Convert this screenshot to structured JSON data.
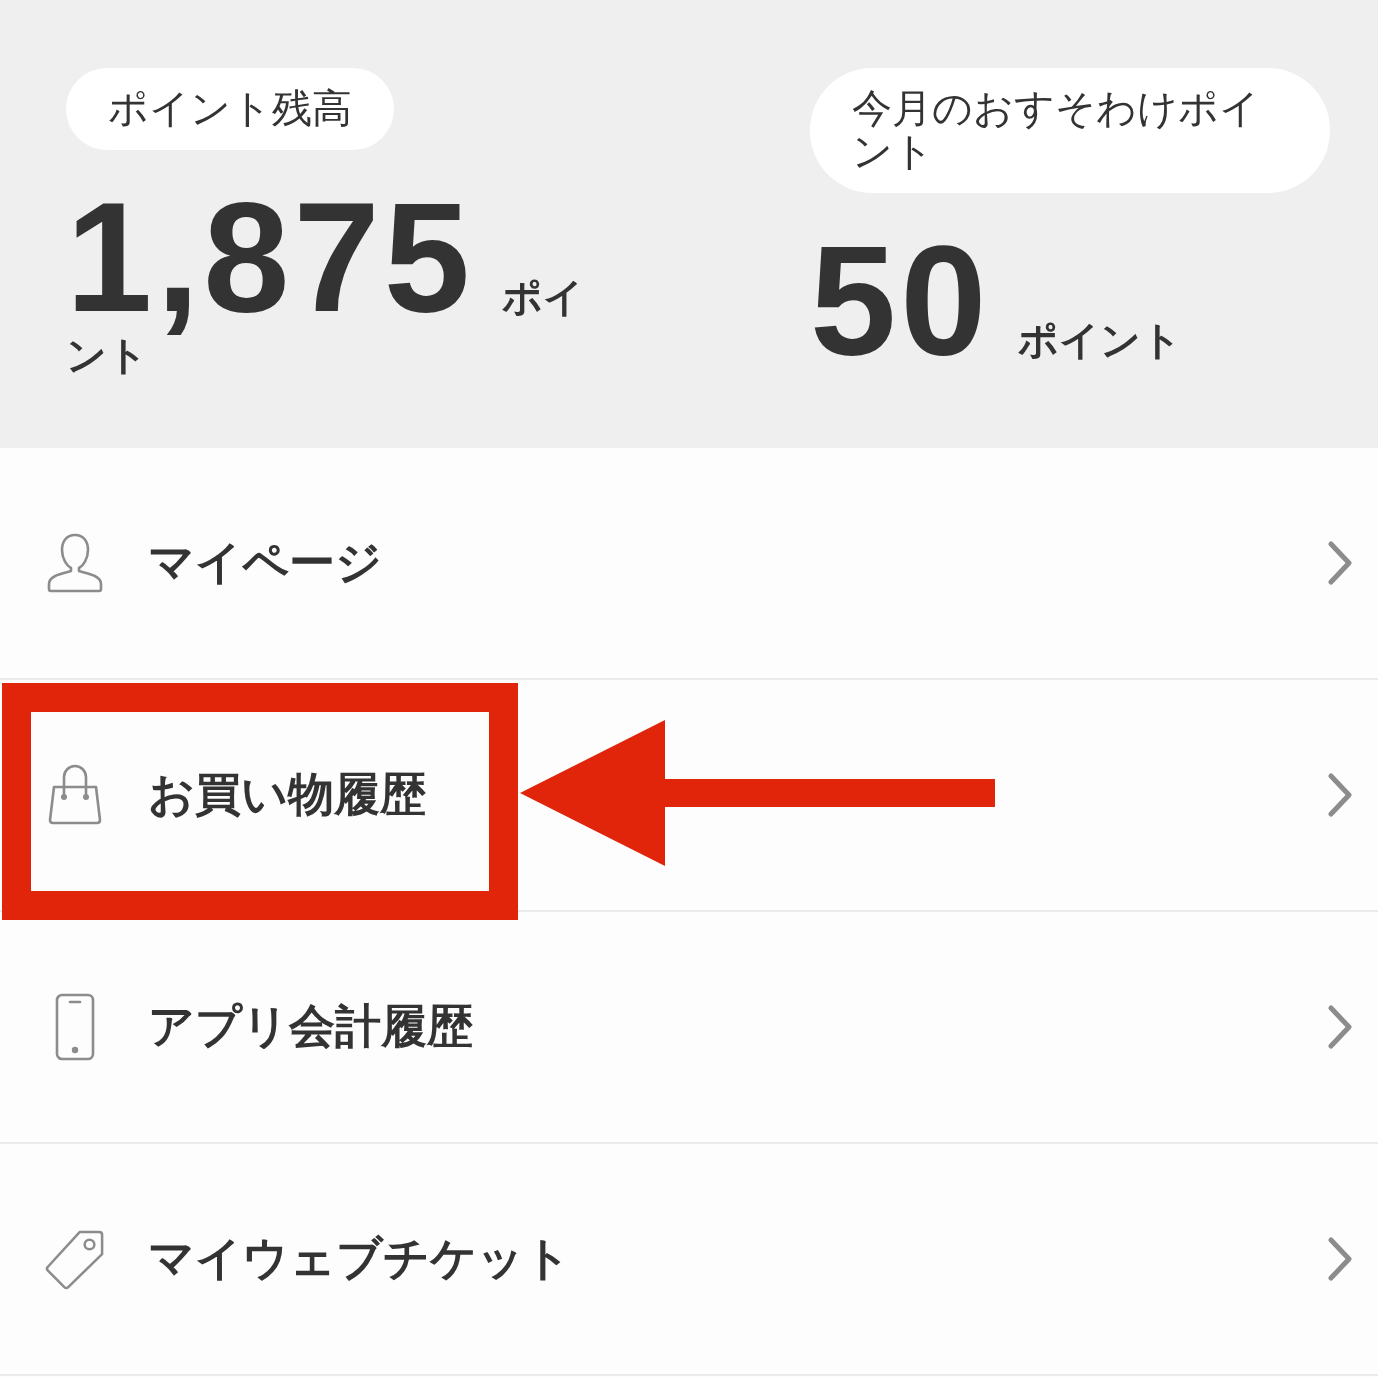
{
  "points_balance": {
    "label": "ポイント残高",
    "value": "1,875",
    "unit": "ポイント"
  },
  "monthly_share_points": {
    "label": "今月のおすそわけポイント",
    "value": "50",
    "unit": "ポイント"
  },
  "menu": [
    {
      "label": "マイページ",
      "kind": "user",
      "highlighted": false
    },
    {
      "label": "お買い物履歴",
      "kind": "bag",
      "highlighted": true
    },
    {
      "label": "アプリ会計履歴",
      "kind": "phone",
      "highlighted": false
    },
    {
      "label": "マイウェブチケット",
      "kind": "tag",
      "highlighted": false
    }
  ]
}
